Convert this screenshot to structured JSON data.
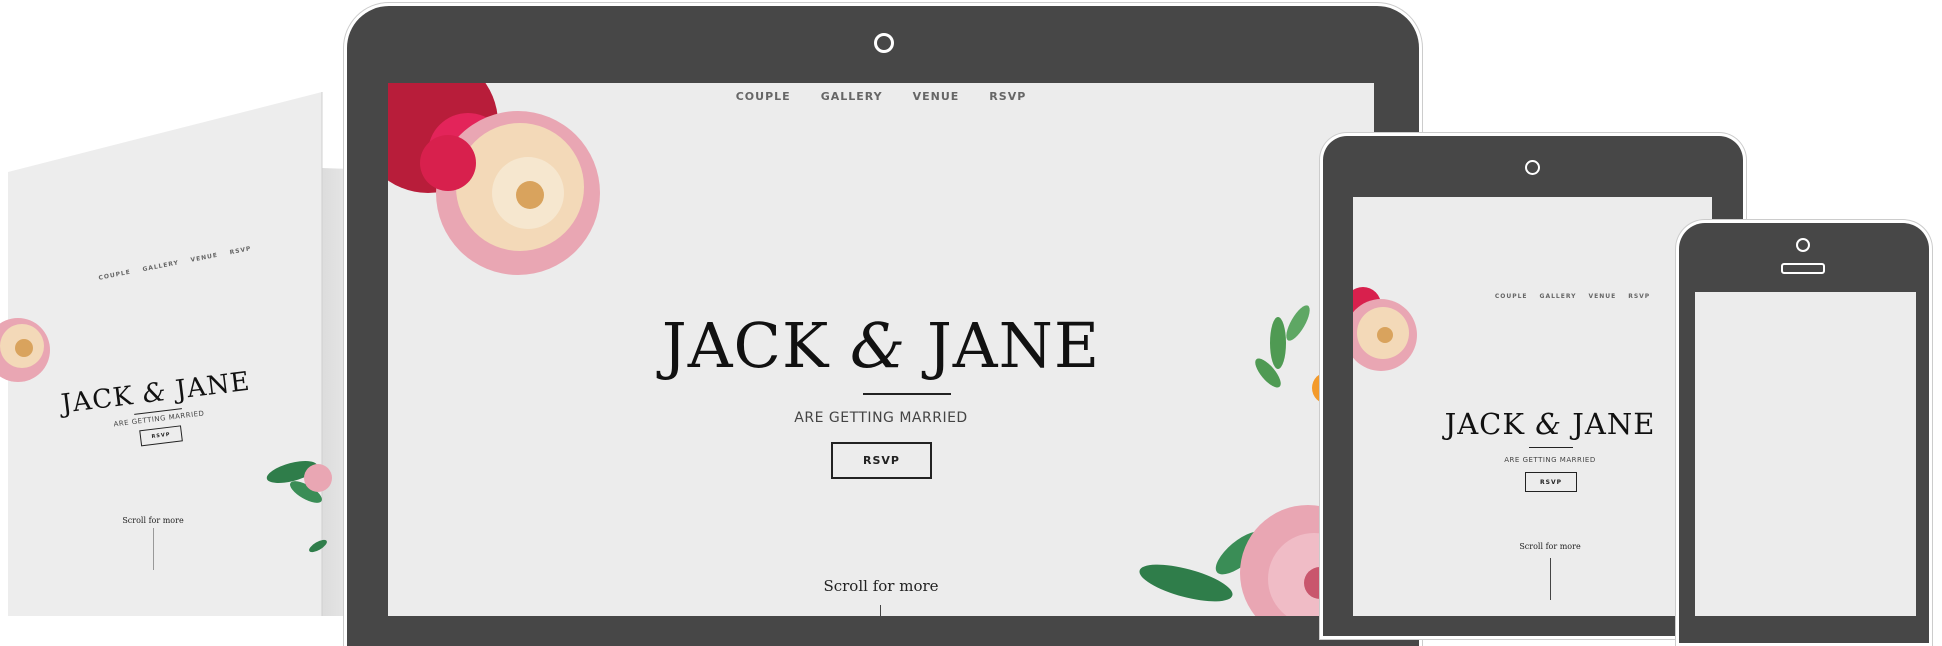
{
  "colors": {
    "bezel": "#474747",
    "screen": "#ececec",
    "text": "#111111",
    "nav": "#666666",
    "rose_red": "#d8204d",
    "peony_cream": "#f3d9b8",
    "peony_pink": "#e9a6b3",
    "leaf_green": "#2f7d4a"
  },
  "site": {
    "nav": {
      "couple": "COUPLE",
      "gallery": "GALLERY",
      "venue": "VENUE",
      "rsvp": "RSVP"
    },
    "title_left": "JACK",
    "title_amp": "&",
    "title_right": "JANE",
    "subtitle": "ARE GETTING MARRIED",
    "rsvp_button": "RSVP",
    "scroll_hint": "Scroll for more"
  },
  "icons": [
    "camera-icon",
    "home-button-icon",
    "flower-decoration",
    "leaf-decoration"
  ]
}
